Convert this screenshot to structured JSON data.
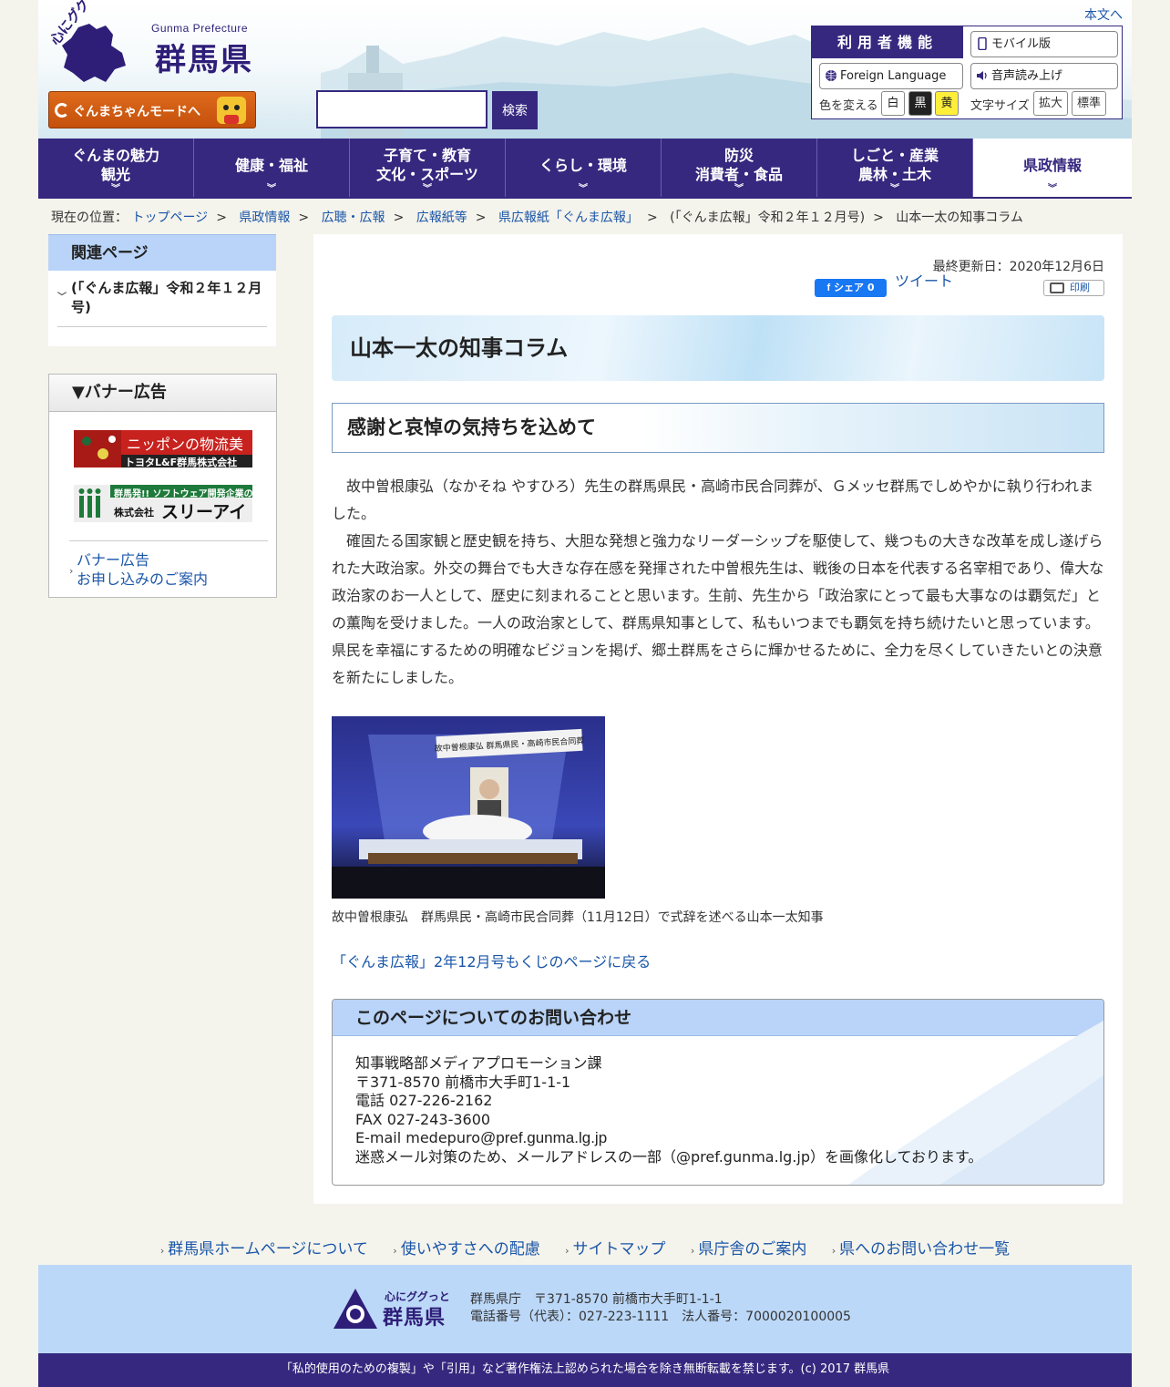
{
  "header": {
    "logo_catch": "心にググっと",
    "logo_en": "Gunma Prefecture",
    "logo_ja": "群馬県",
    "skip_link": "本文へ",
    "gunmachan_mode": "ぐんまちゃんモードへ",
    "search_value": "",
    "search_button": "検索"
  },
  "utility": {
    "title": "利用者機能",
    "mobile": "モバイル版",
    "foreign": "Foreign Language",
    "voice": "音声読み上げ",
    "color_label": "色を変える",
    "colors": [
      "白",
      "黒",
      "黄"
    ],
    "fontsize_label": "文字サイズ",
    "enlarge": "拡大",
    "standard": "標準"
  },
  "nav": [
    {
      "line1": "ぐんまの魅力",
      "line2": "観光"
    },
    {
      "line1": "健康・福祉",
      "line2": ""
    },
    {
      "line1": "子育て・教育",
      "line2": "文化・スポーツ"
    },
    {
      "line1": "くらし・環境",
      "line2": ""
    },
    {
      "line1": "防災",
      "line2": "消費者・食品"
    },
    {
      "line1": "しごと・産業",
      "line2": "農林・土木"
    },
    {
      "line1": "県政情報",
      "line2": ""
    }
  ],
  "breadcrumb": {
    "prefix": "現在の位置：",
    "items": [
      "トップページ",
      "県政情報",
      "広聴・広報",
      "広報紙等",
      "県広報紙「ぐんま広報」",
      "(「ぐんま広報」令和２年１２月号)",
      "山本一太の知事コラム"
    ],
    "separator": ">"
  },
  "sidebar": {
    "related_title": "関連ページ",
    "related_item": "(「ぐんま広報」令和２年１２月号)",
    "banner_title": "▼バナー広告",
    "ad1_line1": "ニッポンの物流美",
    "ad1_line2": "トヨタL&F群馬株式会社",
    "ad2_line1": "群馬発!! ソフトウェア開発企業の",
    "ad2_small": "株式会社",
    "ad2_big": "スリーアイ",
    "banner_link_line1": "バナー広告",
    "banner_link_line2": "お申し込みのご案内"
  },
  "main": {
    "updated": "最終更新日：2020年12月6日",
    "fb_share": "シェア 0",
    "tweet": "ツイート",
    "print": "印刷",
    "title": "山本一太の知事コラム",
    "subtitle": "感謝と哀悼の気持ちを込めて",
    "paragraph1": "故中曽根康弘（なかそね やすひろ）先生の群馬県民・高崎市民合同葬が、Ｇメッセ群馬でしめやかに執り行われました。",
    "paragraph2": "確固たる国家観と歴史観を持ち、大胆な発想と強力なリーダーシップを駆使して、幾つもの大きな改革を成し遂げられた大政治家。外交の舞台でも大きな存在感を発揮された中曽根先生は、戦後の日本を代表する名宰相であり、偉大な政治家のお一人として、歴史に刻まれることと思います。生前、先生から「政治家にとって最も大事なのは覇気だ」との薫陶を受けました。一人の政治家として、群馬県知事として、私もいつまでも覇気を持ち続けたいと思っています。県民を幸福にするための明確なビジョンを掲げ、郷土群馬をさらに輝かせるために、全力を尽くしていきたいとの決意を新たにしました。",
    "photo_banner": "故中曽根康弘 群馬県民・高崎市民合同葬",
    "caption": "故中曽根康弘　群馬県民・高崎市民合同葬（11月12日）で式辞を述べる山本一太知事",
    "back_link": "「ぐんま広報」2年12月号もくじのページに戻る"
  },
  "contact": {
    "title": "このページについてのお問い合わせ",
    "dept": "知事戦略部メディアプロモーション課",
    "address": "〒371-8570 前橋市大手町1-1-1",
    "phone": "電話 027-226-2162",
    "fax": "FAX 027-243-3600",
    "email_prefix": "E-mail medepuro",
    "email_domain": "@pref.gunma.lg.jp",
    "note": "迷惑メール対策のため、メールアドレスの一部（@pref.gunma.lg.jp）を画像化しております。"
  },
  "footer": {
    "links": [
      "群馬県ホームページについて",
      "使いやすさへの配慮",
      "サイトマップ",
      "県庁舎のご案内",
      "県へのお問い合わせ一覧"
    ],
    "logo_small": "心にググっと",
    "logo_big": "群馬県",
    "address_line1": "群馬県庁　〒371-8570 前橋市大手町1-1-1",
    "address_line2": "電話番号（代表）：027-223-1111　法人番号：7000020100005",
    "copyright": "「私的使用のための複製」や「引用」など著作権法上認められた場合を除き無断転載を禁じます。(c) 2017 群馬県"
  },
  "colors": {
    "brand_purple": "#36287f",
    "link_blue": "#1a56a8",
    "heading_blue": "#b9d4f8"
  }
}
